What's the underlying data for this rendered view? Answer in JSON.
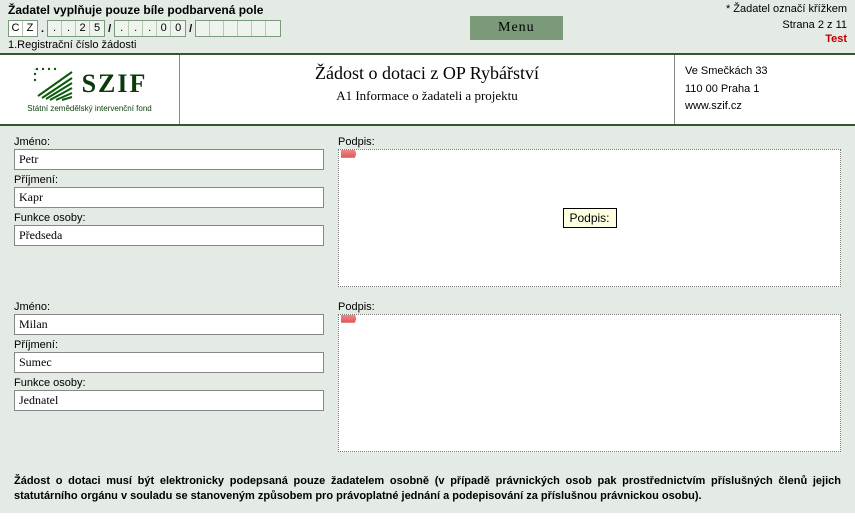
{
  "top": {
    "instruction": "Žadatel vyplňuje pouze bíle podbarvená pole",
    "hint": "* Žadatel označí křížkem",
    "page_info": "Strana 2 z 11",
    "test": "Test",
    "menu": "Menu",
    "reg_label": "1.Registrační číslo žádosti",
    "reg": {
      "g1": [
        "C",
        "Z"
      ],
      "g2": [
        ".",
        ".",
        "2",
        "5"
      ],
      "g3": [
        ".",
        ".",
        ".",
        "0",
        "0"
      ],
      "g4": [
        "",
        "",
        "",
        "",
        "",
        ""
      ]
    }
  },
  "header": {
    "title": "Žádost o dotaci z OP Rybářství",
    "subtitle": "A1 Informace o žadateli a projektu",
    "addr1": "Ve Smečkách 33",
    "addr2": "110 00 Praha 1",
    "addr3": "www.szif.cz",
    "logo_big": "SZIF",
    "logo_sub": "Státní zemědělský intervenční fond"
  },
  "labels": {
    "jmeno": "Jméno:",
    "prijmeni": "Příjmení:",
    "funkce": "Funkce osoby:",
    "podpis": "Podpis:",
    "podpis_tooltip": "Podpis:"
  },
  "persons": [
    {
      "jmeno": "Petr",
      "prijmeni": "Kapr",
      "funkce": "Předseda",
      "show_tooltip": true
    },
    {
      "jmeno": "Milan",
      "prijmeni": "Sumec",
      "funkce": "Jednatel",
      "show_tooltip": false
    }
  ],
  "footer": "Žádost o dotaci musí být elektronicky podepsaná pouze žadatelem osobně (v případě právnických osob pak prostřednictvím příslušných členů jejich statutárního orgánu v souladu se stanoveným způsobem pro právoplatné jednání a podepisování za příslušnou právnickou osobu)."
}
